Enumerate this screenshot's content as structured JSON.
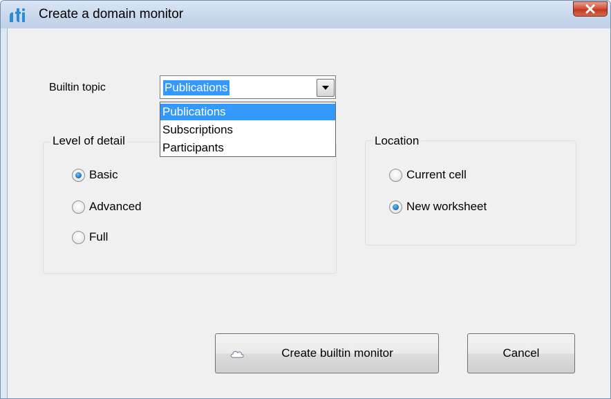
{
  "window": {
    "title": "Create a domain monitor",
    "logo_text": "rti"
  },
  "builtin_topic": {
    "label": "Builtin topic",
    "selected_value": "Publications",
    "options": [
      "Publications",
      "Subscriptions",
      "Participants"
    ],
    "highlighted_option": "Publications"
  },
  "level_of_detail": {
    "title": "Level of detail",
    "options": [
      {
        "label": "Basic",
        "checked": true
      },
      {
        "label": "Advanced",
        "checked": false
      },
      {
        "label": "Full",
        "checked": false
      }
    ]
  },
  "location": {
    "title": "Location",
    "options": [
      {
        "label": "Current cell",
        "checked": false
      },
      {
        "label": "New worksheet",
        "checked": true
      }
    ]
  },
  "buttons": {
    "create_label": "Create builtin monitor",
    "create_icon": "cloud-icon",
    "cancel_label": "Cancel"
  },
  "colors": {
    "selection": "#3399ff",
    "close_button": "#c13a1f",
    "logo": "#2d8ad6"
  }
}
